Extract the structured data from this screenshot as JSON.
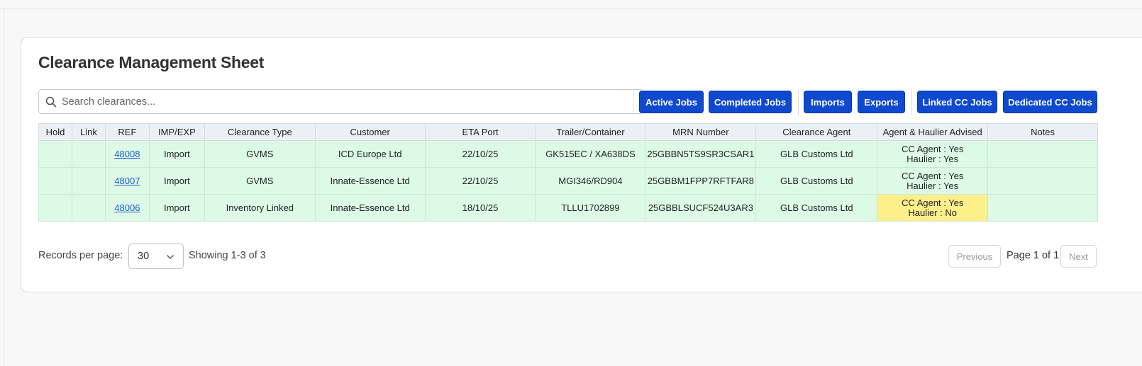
{
  "page": {
    "title": "Clearance Management Sheet",
    "search_placeholder": "Search clearances..."
  },
  "filters": [
    {
      "label": "Active Jobs"
    },
    {
      "label": "Completed Jobs"
    },
    {
      "label": "Imports"
    },
    {
      "label": "Exports"
    },
    {
      "label": "Linked CC Jobs"
    },
    {
      "label": "Dedicated CC Jobs"
    }
  ],
  "table": {
    "columns": [
      "Hold",
      "Link",
      "REF",
      "IMP/EXP",
      "Clearance Type",
      "Customer",
      "ETA Port",
      "Trailer/Container",
      "MRN Number",
      "Clearance Agent",
      "Agent & Haulier Advised",
      "Notes"
    ],
    "rows": [
      {
        "hold": "",
        "link": "",
        "ref": "48008",
        "impexp": "Import",
        "type": "GVMS",
        "customer": "ICD Europe Ltd",
        "eta": "22/10/25",
        "trailer": "GK515EC / XA638DS",
        "mrn": "25GBBN5TS9SR3CSAR1",
        "agent": "GLB Customs Ltd",
        "advised_agent": "CC Agent : Yes",
        "advised_haulier": "Haulier : Yes",
        "notes": ""
      },
      {
        "hold": "",
        "link": "",
        "ref": "48007",
        "impexp": "Import",
        "type": "GVMS",
        "customer": "Innate-Essence Ltd",
        "eta": "22/10/25",
        "trailer": "MGI346/RD904",
        "mrn": "25GBBM1FPP7RFTFAR8",
        "agent": "GLB Customs Ltd",
        "advised_agent": "CC Agent : Yes",
        "advised_haulier": "Haulier : Yes",
        "notes": ""
      },
      {
        "hold": "",
        "link": "",
        "ref": "48006",
        "impexp": "Import",
        "type": "Inventory Linked",
        "customer": "Innate-Essence Ltd",
        "eta": "18/10/25",
        "trailer": "TLLU1702899",
        "mrn": "25GBBLSUCF524U3AR3",
        "agent": "GLB Customs Ltd",
        "advised_agent": "CC Agent : Yes",
        "advised_haulier": "Haulier : No",
        "notes": ""
      }
    ]
  },
  "pagination": {
    "records_label": "Records per page:",
    "per_page": "30",
    "showing": "Showing 1-3 of 3",
    "previous": "Previous",
    "page_info": "Page 1 of 1",
    "next": "Next"
  },
  "colors": {
    "button": "#0e49cf",
    "row_bg": "#dcfae6",
    "warn_bg": "#fdef8a",
    "link": "#1d5ccf"
  }
}
